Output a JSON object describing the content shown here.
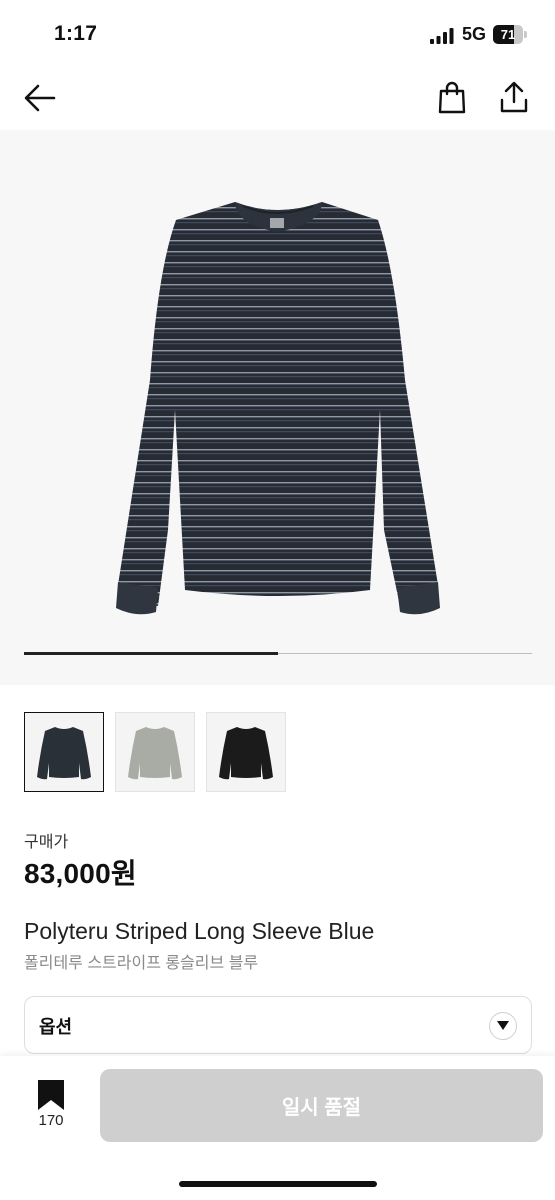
{
  "status_bar": {
    "time": "1:17",
    "network": "5G",
    "battery": "71",
    "battery_level": 0.71
  },
  "header": {
    "back_icon": "arrow-left-icon",
    "bag_icon": "shopping-bag-icon",
    "share_icon": "share-icon"
  },
  "gallery": {
    "progress": 0.5,
    "thumbnails": [
      "navy-striped-longsleeve",
      "grey-striped-longsleeve",
      "black-striped-longsleeve"
    ]
  },
  "product": {
    "price_label": "구매가",
    "price": "83,000원",
    "name_en": "Polyteru Striped Long Sleeve Blue",
    "name_ko": "폴리테루 스트라이프 롱슬리브 블루"
  },
  "option": {
    "label": "옵션"
  },
  "bottom_bar": {
    "bookmark_count": "170",
    "cta_label": "일시 품절"
  },
  "colors": {
    "cta_bg": "#cfcfcf",
    "shirt_navy": "#2a3038"
  }
}
